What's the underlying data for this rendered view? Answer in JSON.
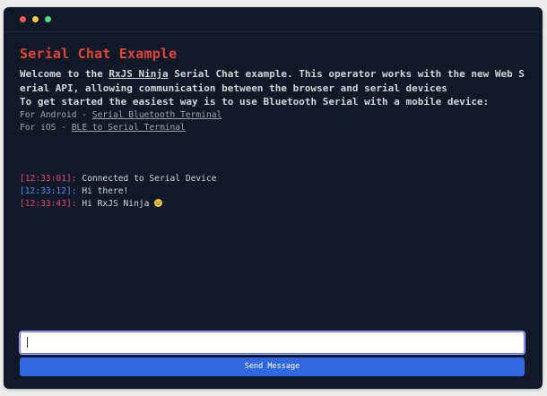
{
  "window": {
    "title": "Serial Chat Example"
  },
  "intro": {
    "line_prefix": "Welcome to the ",
    "rxjs_link": "RxJS Ninja",
    "line_suffix": " Serial Chat example. This operator works with the new Web Serial API, allowing communication between the browser and serial devices",
    "bluetooth_line": "To get started the easiest way is to use Bluetooth Serial with a mobile device:"
  },
  "links": {
    "android_prefix": "For Android - ",
    "android_link": "Serial Bluetooth Terminal",
    "ios_prefix": "For iOS - ",
    "ios_link": "BLE to Serial Terminal"
  },
  "messages": [
    {
      "time": "[12:33:01]:",
      "text": " Connected to Serial Device",
      "kind": "sys"
    },
    {
      "time": "[12:33:12]:",
      "text": " Hi there!",
      "kind": "me"
    },
    {
      "time": "[12:33:43]:",
      "text": " Hi RxJS Ninja ",
      "kind": "sys",
      "emoji": "smiley-emoji"
    }
  ],
  "composer": {
    "input_value": "",
    "send_label": "Send Message"
  },
  "colors": {
    "background": "#111827",
    "title": "#e0443a",
    "system_time": "#e2457a",
    "user_time": "#4b8de8",
    "button": "#3168e2"
  }
}
